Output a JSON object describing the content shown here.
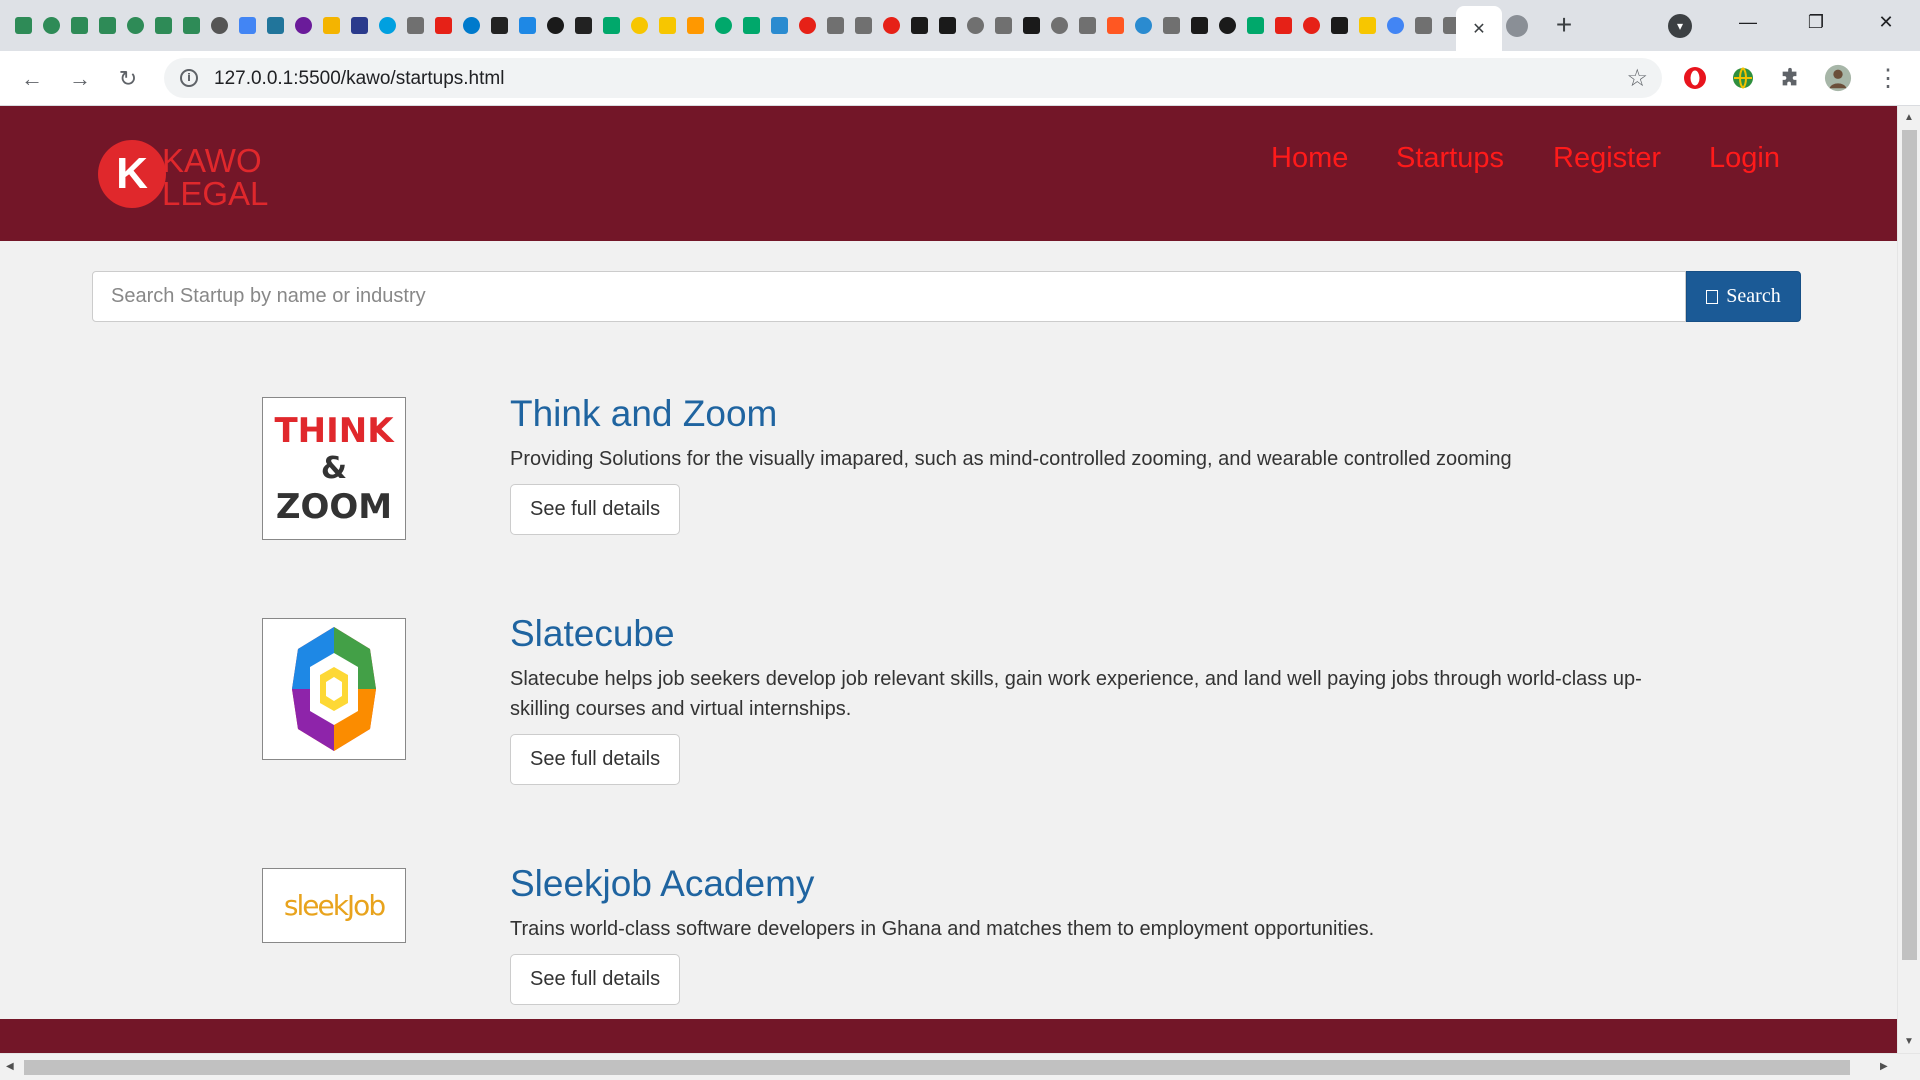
{
  "browser": {
    "url": "127.0.0.1:5500/kawo/startups.html",
    "new_tab_symbol": "+",
    "close_tab_symbol": "✕",
    "favicons": [
      "#2e8b57",
      "#2e8b57",
      "#2e8b57",
      "#2e8b57",
      "#2e8b57",
      "#2e8b57",
      "#2e8b57",
      "#555555",
      "#4285f4",
      "#21759b",
      "#6a1b9a",
      "#f4b400",
      "#2a3a8c",
      "#00a0e0",
      "#707070",
      "#e62117",
      "#007acc",
      "#222222",
      "#1e88e5",
      "#1a1a1a",
      "#222222",
      "#00a86b",
      "#f7c600",
      "#f7c600",
      "#ff9800",
      "#00a86b",
      "#00a86b",
      "#2a8bd0",
      "#e62117",
      "#707070",
      "#707070",
      "#e62117",
      "#1a1a1a",
      "#1a1a1a",
      "#707070",
      "#707070",
      "#1a1a1a",
      "#707070",
      "#707070",
      "#ff5722",
      "#2a8bd0",
      "#707070",
      "#1a1a1a",
      "#1a1a1a",
      "#00a86b",
      "#e62117",
      "#e62117",
      "#1a1a1a",
      "#f7c600",
      "#4285f4",
      "#707070",
      "#707070"
    ]
  },
  "header": {
    "logo_letter": "K",
    "logo_line1": "KAWO",
    "logo_line2": "LEGAL",
    "nav": [
      "Home",
      "Startups",
      "Register",
      "Login"
    ]
  },
  "search": {
    "placeholder": "Search Startup by name or industry",
    "button_label": "Search"
  },
  "startups": [
    {
      "name": "Think and Zoom",
      "description": "Providing Solutions for the visually imapared, such as mind-controlled zooming, and wearable controlled zooming",
      "button": "See full details",
      "logo_lines": [
        "THINK",
        "&",
        "ZOOM"
      ]
    },
    {
      "name": "Slatecube",
      "description": "Slatecube helps job seekers develop job relevant skills, gain work experience, and land well paying jobs through world-class up-skilling courses and virtual internships.",
      "button": "See full details"
    },
    {
      "name": "Sleekjob Academy",
      "description": "Trains world-class software developers in Ghana and matches them to employment opportunities.",
      "button": "See full details",
      "logo_text": "sleekJob"
    }
  ],
  "colors": {
    "header_bg": "#731628",
    "nav_link": "#ff1a1a",
    "title_blue": "#1f64a0",
    "search_button": "#1b5a96"
  }
}
